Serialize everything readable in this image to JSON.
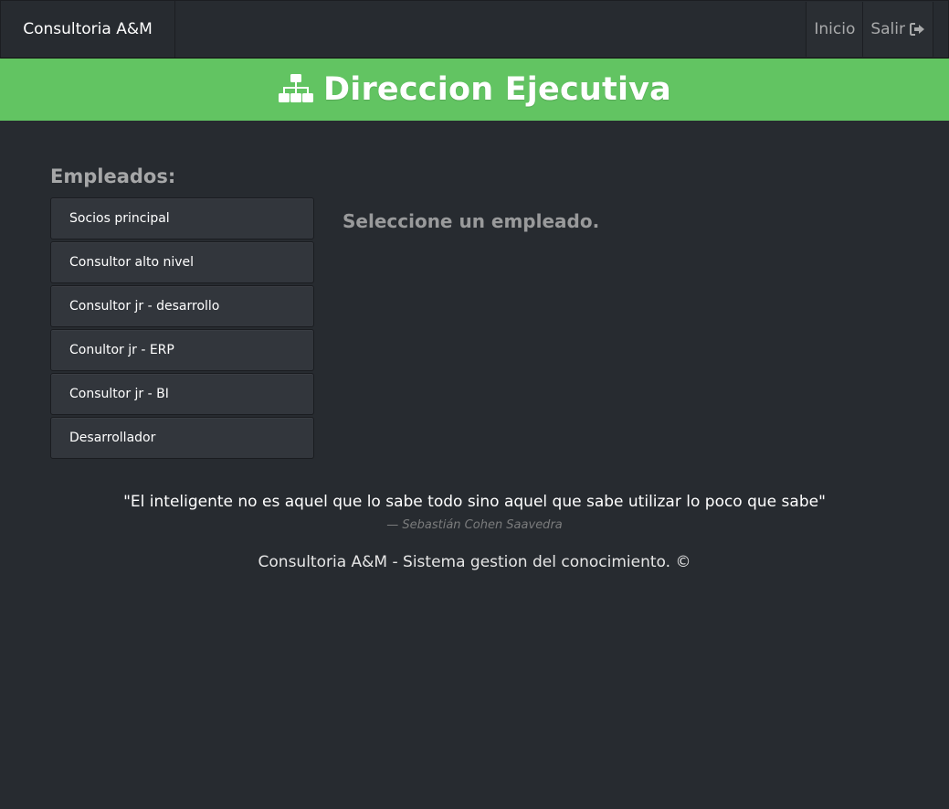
{
  "navbar": {
    "brand": "Consultoria A&M",
    "links": [
      {
        "label": "Inicio",
        "icon": ""
      },
      {
        "label": "Salir",
        "icon": "sign-out-icon"
      }
    ]
  },
  "banner": {
    "icon": "sitemap-icon",
    "title": "Direccion Ejecutiva",
    "color": "#62c462"
  },
  "employees": {
    "heading": "Empleados:",
    "items": [
      "Socios principal",
      "Consultor alto nivel",
      "Consultor jr - desarrollo",
      "Conultor jr - ERP",
      "Consultor jr - BI",
      "Desarrollador"
    ]
  },
  "detail": {
    "placeholder": "Seleccione un empleado."
  },
  "quote": {
    "text": "\"El inteligente no es aquel que lo sabe todo sino aquel que sabe utilizar lo poco que sabe\"",
    "author": "— Sebastián Cohen Saavedra"
  },
  "footer": {
    "text": "Consultoria A&M - Sistema gestion del conocimiento. ©"
  },
  "colors": {
    "background": "#272b30",
    "accent": "#62c462"
  }
}
